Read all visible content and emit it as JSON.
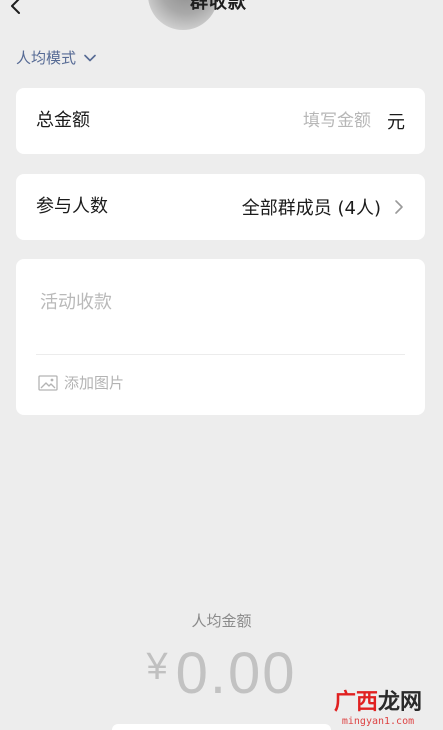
{
  "header": {
    "title": "群收款",
    "back_icon": "chevron-left-icon"
  },
  "mode": {
    "label": "人均模式",
    "icon": "chevron-down-icon",
    "accent_color": "#576b95"
  },
  "amount_row": {
    "label": "总金额",
    "placeholder": "填写金额",
    "value": "",
    "unit": "元"
  },
  "people_row": {
    "label": "参与人数",
    "value": "全部群成员 (4人)",
    "icon": "chevron-right-icon"
  },
  "description": {
    "placeholder": "活动收款",
    "value": "",
    "add_image_label": "添加图片",
    "add_image_icon": "image-icon"
  },
  "summary": {
    "label": "人均金额",
    "currency": "¥",
    "amount": "0.00"
  },
  "watermark": {
    "text_part1": "广西",
    "text_part2": "龙网",
    "url": "mingyan1.com"
  }
}
